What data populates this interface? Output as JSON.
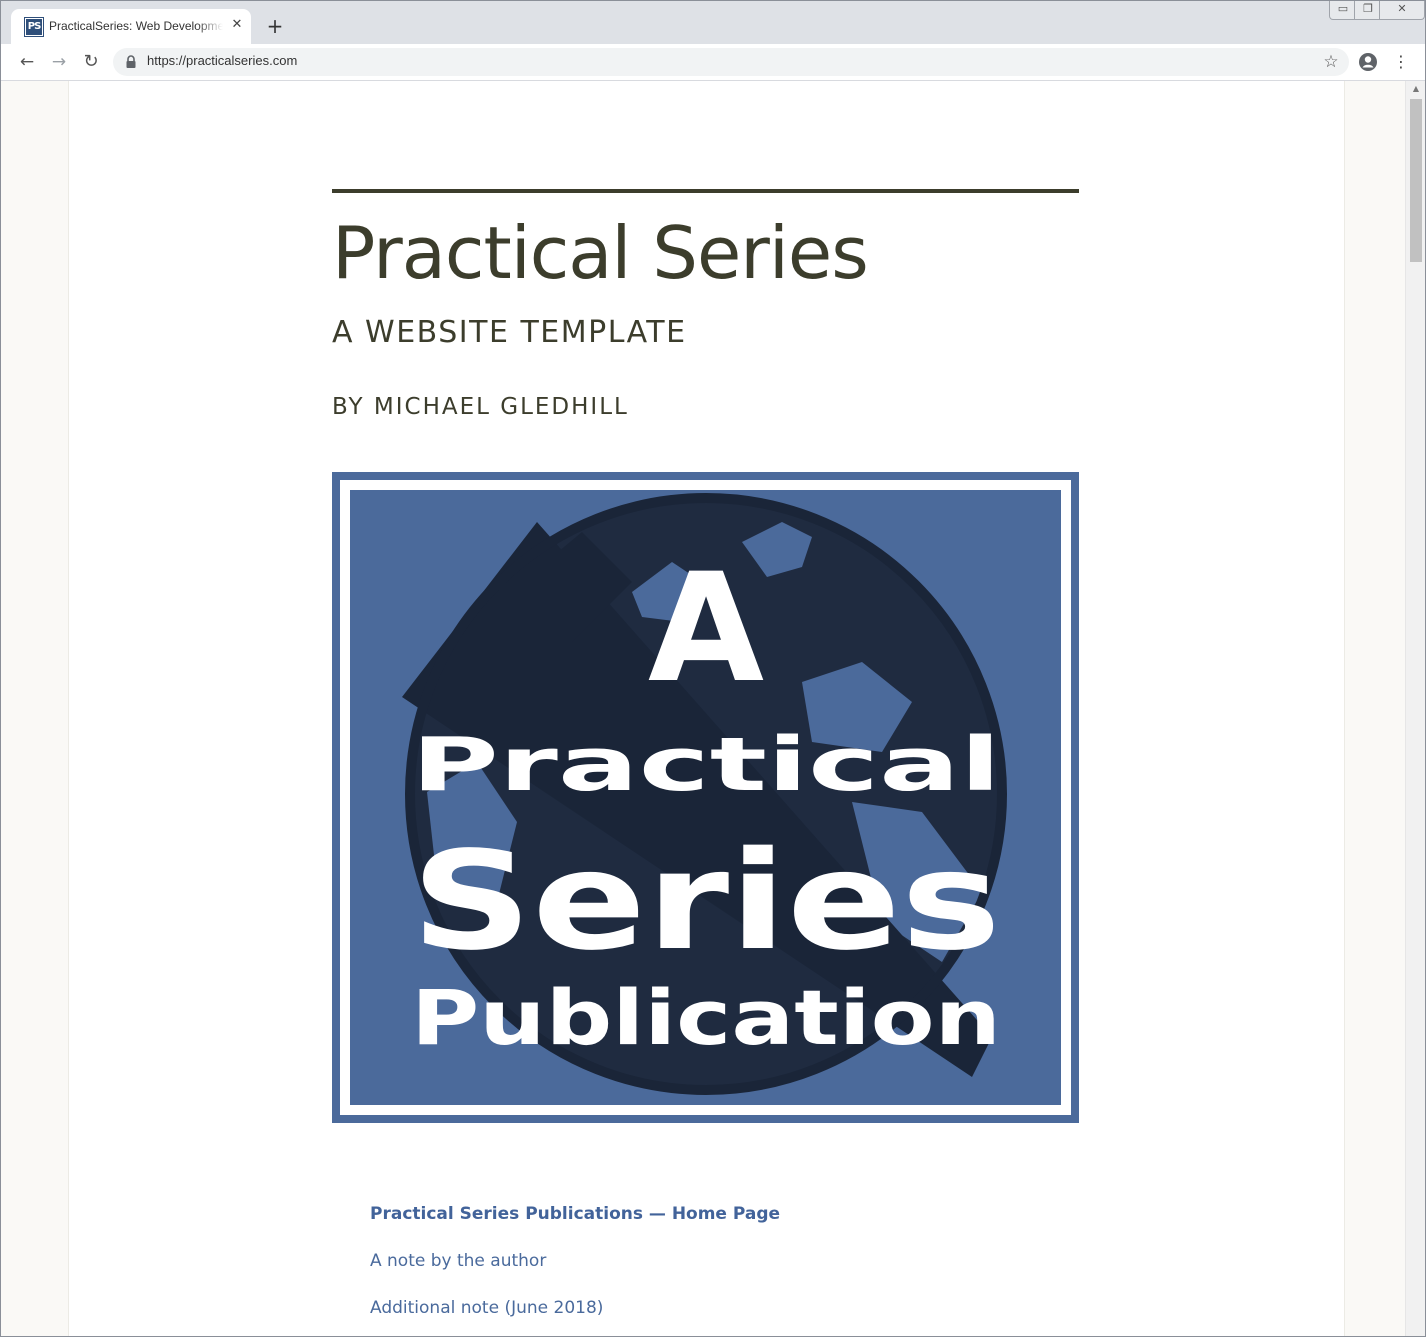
{
  "browser": {
    "tab": {
      "favicon_text": "PS",
      "title": "PracticalSeries: Web Development",
      "close_glyph": "✕"
    },
    "new_tab_glyph": "+",
    "window_controls": {
      "minimize": "▭",
      "restore": "❐",
      "close": "✕"
    },
    "toolbar": {
      "back_glyph": "←",
      "forward_glyph": "→",
      "reload_glyph": "↻",
      "url": "https://practicalseries.com",
      "bookmark_glyph": "☆",
      "menu_glyph": "⋮"
    },
    "scrollbar": {
      "up_glyph": "▲"
    }
  },
  "page": {
    "title": "Practical Series",
    "subtitle": "A WEBSITE TEMPLATE",
    "byline": "BY MICHAEL GLEDHILL",
    "cover": {
      "line1": "A",
      "line2": "Practical",
      "line3": "Series",
      "line4": "Publication",
      "colors": {
        "blue": "#4b6a9b",
        "dark": "#1f2b40",
        "white": "#ffffff"
      }
    },
    "links": [
      {
        "label": "Practical Series Publications — Home Page",
        "bold": true
      },
      {
        "label": "A note by the author",
        "bold": false
      },
      {
        "label": "Additional note (June 2018)",
        "bold": false
      }
    ]
  }
}
